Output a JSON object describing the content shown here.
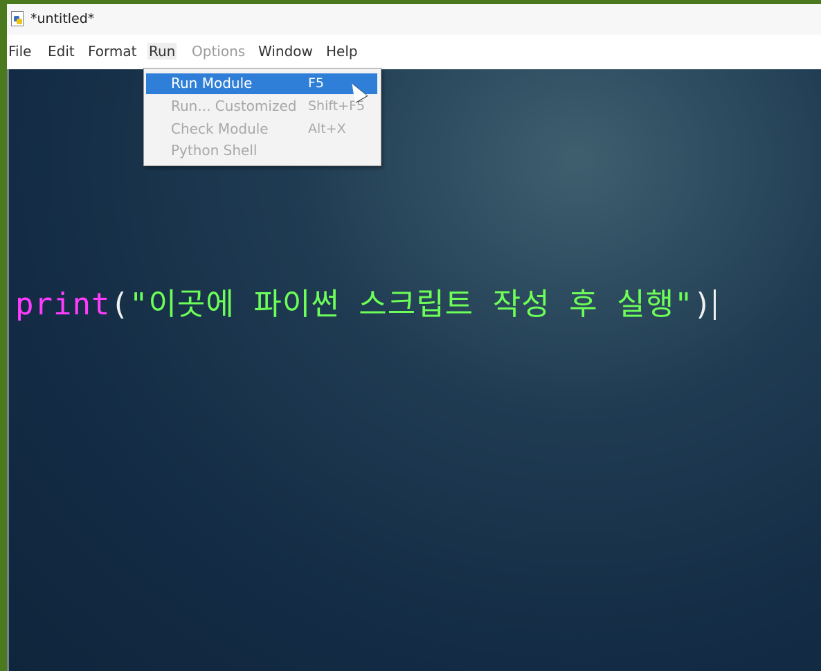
{
  "window": {
    "title": "*untitled*",
    "icon": "python-file-icon"
  },
  "menubar": {
    "items": [
      {
        "label": "File"
      },
      {
        "label": "Edit"
      },
      {
        "label": "Format"
      },
      {
        "label": "Run"
      },
      {
        "label": "Options"
      },
      {
        "label": "Window"
      },
      {
        "label": "Help"
      }
    ]
  },
  "run_menu": {
    "items": [
      {
        "label": "Run Module",
        "accel": "F5"
      },
      {
        "label": "Run... Customized",
        "accel": "Shift+F5"
      },
      {
        "label": "Check Module",
        "accel": "Alt+X"
      },
      {
        "label": "Python Shell",
        "accel": ""
      }
    ]
  },
  "editor": {
    "code": {
      "keyword": "print",
      "open": "(",
      "string": "\"이곳에 파이썬 스크립트 작성 후 실행\"",
      "close": ")"
    }
  },
  "colors": {
    "keyword": "#ff3cff",
    "string": "#6dff58",
    "editor_bg": "#132b44",
    "selection": "#2f7fd8"
  }
}
